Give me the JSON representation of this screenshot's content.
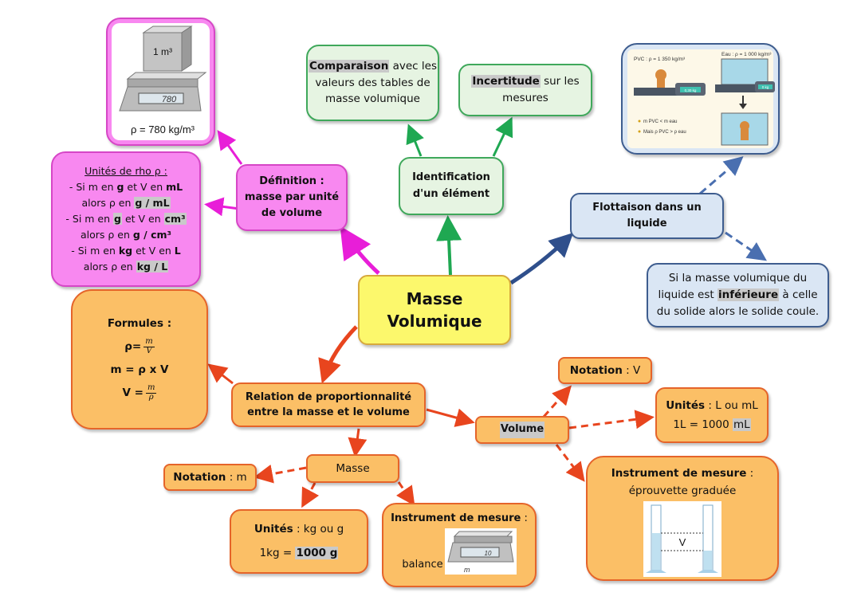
{
  "center": {
    "line1": "Masse",
    "line2": "Volumique"
  },
  "definition": {
    "line1": "Définition :",
    "line2": "masse par unité",
    "line3": "de volume"
  },
  "example_image": {
    "cube_label": "1 m³",
    "scale_display": "780",
    "caption": "ρ = 780 kg/m³"
  },
  "units_rho": {
    "title": "Unités de rho ρ :",
    "lines": [
      {
        "pre": "- Si m en ",
        "b1": "g",
        "mid": " et V en ",
        "b2": "mL"
      },
      {
        "pre": "alors ρ en ",
        "b1": "g / mL"
      },
      {
        "pre": "- Si m en ",
        "b1": "g",
        "mid": " et V en ",
        "b2": "cm³"
      },
      {
        "pre": "alors ρ en ",
        "b1": "g / cm³"
      },
      {
        "pre": "- Si m en ",
        "b1": "kg",
        "mid": " et V en ",
        "b2": "L"
      },
      {
        "pre": "alors ρ en ",
        "b1": "kg / L"
      }
    ]
  },
  "identification": {
    "line1": "Identification",
    "line2": "d'un élément"
  },
  "comparison": {
    "bold": "Comparaison",
    "rest1": " avec les",
    "line2": "valeurs des tables de",
    "line3": "masse volumique"
  },
  "uncertainty": {
    "bold": "Incertitude",
    "rest1": " sur les",
    "line2": "mesures"
  },
  "flotation": {
    "line1": "Flottaison dans un",
    "line2": "liquide"
  },
  "flotation_image": {
    "pvc_label": "PVC : ρ = 1 350 kg/m³",
    "water_label": "Eau : ρ = 1 000 kg/m³",
    "display_left": "0,30 kg",
    "display_right": "0 kg",
    "bullet1": "m PVC < m eau",
    "bullet2": "Mais ρ PVC > ρ eau"
  },
  "sink_rule": {
    "line1": "Si la masse volumique du",
    "pre2": "liquide est ",
    "bold2": "inférieure",
    "post2": " à celle",
    "line3": "du solide alors le solide coule."
  },
  "formulas": {
    "title": "Formules :",
    "f1_left": "ρ=",
    "f1_num": "m",
    "f1_den": "V",
    "f2": "m = ρ x V",
    "f3_left": "V =",
    "f3_num": "m",
    "f3_den": "ρ"
  },
  "relation": {
    "line1": "Relation de proportionnalité",
    "line2": "entre la masse et le volume"
  },
  "volume": {
    "label": "Volume",
    "notation": {
      "bold": "Notation",
      "rest": " : V"
    },
    "units": {
      "bold": "Unités",
      "rest": " : L ou mL",
      "conv_pre": "1L = 1000 ",
      "conv_hl": "mL"
    },
    "instrument": {
      "bold": "Instrument de mesure",
      "rest": " :",
      "line2": "éprouvette graduée",
      "image_label": "V"
    }
  },
  "mass": {
    "label": "Masse",
    "notation": {
      "bold": "Notation",
      "rest": " : m"
    },
    "units": {
      "bold": "Unités",
      "rest": " : kg ou g",
      "conv_pre": "1kg = ",
      "conv_hl": "1000 g"
    },
    "instrument": {
      "bold": "Instrument de mesure",
      "rest": " :",
      "caption": "balance",
      "image_label": "m",
      "scale_display": "10"
    }
  },
  "colors": {
    "pink": "#f888f0",
    "green": "#3fa85b",
    "blue": "#3e5d8f",
    "orange": "#fbbf66",
    "red_arrow": "#e8451e",
    "magenta_arrow": "#e81ed8",
    "yellow": "#fcf86c"
  }
}
